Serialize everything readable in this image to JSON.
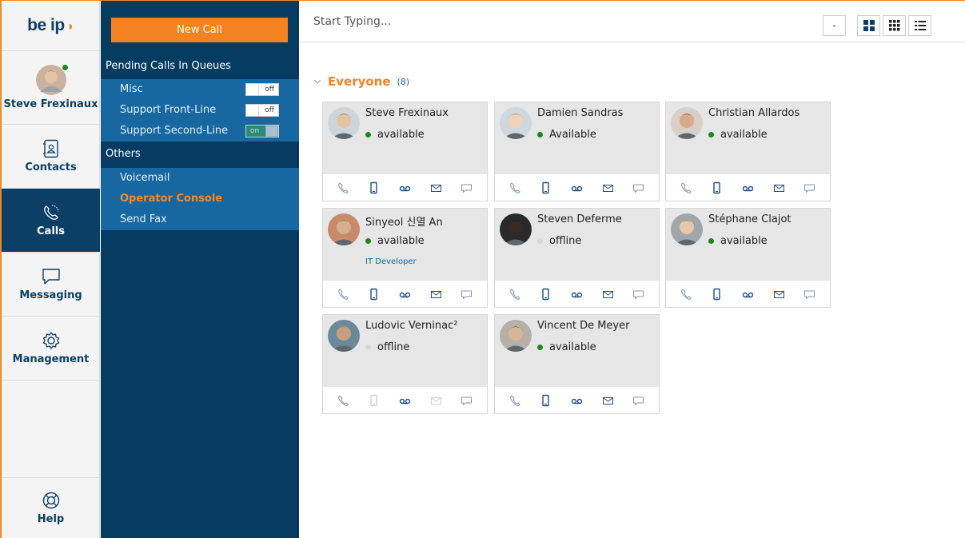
{
  "app": {
    "logo": "be ip"
  },
  "rail": {
    "user_name": "Steve Frexinaux",
    "contacts": "Contacts",
    "calls": "Calls",
    "messaging": "Messaging",
    "management": "Management",
    "help": "Help"
  },
  "panel": {
    "new_call": "New Call",
    "pending_header": "Pending Calls In Queues",
    "queues": [
      {
        "label": "Misc",
        "toggle": "off"
      },
      {
        "label": "Support Front-Line",
        "toggle": "off"
      },
      {
        "label": "Support Second-Line",
        "toggle": "on"
      }
    ],
    "others_header": "Others",
    "menu": [
      "Voicemail",
      "Operator Console",
      "Send Fax"
    ]
  },
  "main": {
    "search_placeholder": "Start Typing...",
    "view_buttons": [
      "-",
      "grid-large-icon",
      "grid-small-icon",
      "list-icon"
    ],
    "group_label": "Everyone",
    "group_count": "(8)",
    "contacts": [
      {
        "name": "Steve Frexinaux",
        "status": "available",
        "online": true,
        "role": ""
      },
      {
        "name": "Damien Sandras",
        "status": "Available",
        "online": true,
        "role": ""
      },
      {
        "name": "Christian Allardos",
        "status": "available",
        "online": true,
        "role": ""
      },
      {
        "name": "Sinyeol 신열 An",
        "status": "available",
        "online": true,
        "role": "IT Developer"
      },
      {
        "name": "Steven Deferme",
        "status": "offline",
        "online": false,
        "role": ""
      },
      {
        "name": "Stéphane Clajot",
        "status": "available",
        "online": true,
        "role": ""
      },
      {
        "name": "Ludovic Verninac²",
        "status": "offline",
        "online": false,
        "role": ""
      },
      {
        "name": "Vincent De Meyer",
        "status": "available",
        "online": true,
        "role": ""
      }
    ]
  },
  "colors": {
    "accent": "#f58220",
    "navy": "#063b62",
    "panel_blue": "#1767a1",
    "available": "#1a8a1a"
  }
}
